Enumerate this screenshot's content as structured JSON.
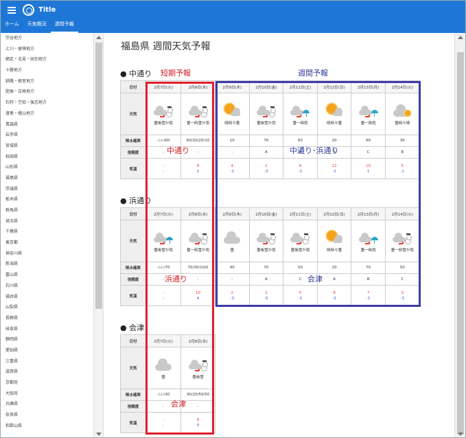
{
  "app": {
    "title": "Title"
  },
  "nav": {
    "tabs": [
      {
        "label": "ホーム"
      },
      {
        "label": "天気概況"
      },
      {
        "label": "週間予報"
      }
    ]
  },
  "sidebar": {
    "items": [
      "宗谷地方",
      "上川・留萌地方",
      "網走・北見・紋別地方",
      "十勝地方",
      "釧路・根室地方",
      "胆振・日高地方",
      "石狩・空知・後志地方",
      "渡島・檜山地方",
      "青森県",
      "岩手県",
      "宮城県",
      "秋田県",
      "山形県",
      "福島県",
      "茨城県",
      "栃木県",
      "群馬県",
      "埼玉県",
      "千葉県",
      "東京都",
      "神奈川県",
      "新潟県",
      "富山県",
      "石川県",
      "福井県",
      "山梨県",
      "長野県",
      "岐阜県",
      "静岡県",
      "愛知県",
      "三重県",
      "滋賀県",
      "京都府",
      "大阪府",
      "兵庫県",
      "奈良県",
      "和歌山県"
    ]
  },
  "page": {
    "title": "福島県 週間天気予報"
  },
  "row_labels": {
    "date": "日付",
    "weather": "天気",
    "pop": "降水確率",
    "reliability": "信頼度",
    "temp": "気温"
  },
  "sections": [
    {
      "name": "中通り",
      "days": [
        {
          "date": "2月7日(火)",
          "icon": "cloud-snow-icon",
          "weather": "曇後雪か雨",
          "pop": "-/-/-/60",
          "rel": "-",
          "tmax": "-",
          "tmin": "-"
        },
        {
          "date": "2月8日(水)",
          "icon": "cloud-snow-icon",
          "weather": "曇一時雪か雨",
          "pop": "60/20/20/10",
          "rel": "-",
          "tmax": "8",
          "tmin": "1"
        },
        {
          "date": "2月9日(木)",
          "icon": "sun-cloud-icon",
          "weather": "晴時々曇",
          "pop": "10",
          "rel": "-",
          "tmax": "4",
          "tmin": "-1"
        },
        {
          "date": "2月10日(金)",
          "icon": "cloud-snow-icon",
          "weather": "曇後雪か雨",
          "pop": "70",
          "rel": "A",
          "tmax": "2",
          "tmin": "-3"
        },
        {
          "date": "2月11日(土)",
          "icon": "cloud-rain-icon",
          "weather": "曇一時雨",
          "pop": "60",
          "rel": "A",
          "tmax": "9",
          "tmin": "-1"
        },
        {
          "date": "2月12日(日)",
          "icon": "sun-cloud-icon",
          "weather": "晴時々曇",
          "pop": "20",
          "rel": "A",
          "tmax": "12",
          "tmin": "-2"
        },
        {
          "date": "2月13日(月)",
          "icon": "cloud-rain-icon",
          "weather": "曇一時雨",
          "pop": "60",
          "rel": "C",
          "tmax": "10",
          "tmin": "1"
        },
        {
          "date": "2月14日(火)",
          "icon": "cloud-sun-icon",
          "weather": "曇時々晴",
          "pop": "30",
          "rel": "B",
          "tmax": "5",
          "tmin": "-1"
        }
      ]
    },
    {
      "name": "浜通り",
      "days": [
        {
          "date": "2月7日(火)",
          "icon": "cloud-rain-icon",
          "weather": "曇後雪か雨",
          "pop": "-/-/-/70",
          "rel": "-",
          "tmax": "-",
          "tmin": "-"
        },
        {
          "date": "2月8日(水)",
          "icon": "cloud-snow-icon",
          "weather": "曇一時雪か雨",
          "pop": "70/30/10/0",
          "rel": "-",
          "tmax": "10",
          "tmin": "4"
        },
        {
          "date": "2月9日(木)",
          "icon": "cloud-icon",
          "weather": "曇",
          "pop": "40",
          "rel": "-",
          "tmax": "2",
          "tmin": "-3"
        },
        {
          "date": "2月10日(金)",
          "icon": "cloud-snow-icon",
          "weather": "曇後雪か雨",
          "pop": "70",
          "rel": "A",
          "tmax": "2",
          "tmin": "-5"
        },
        {
          "date": "2月11日(土)",
          "icon": "cloud-snow-icon",
          "weather": "曇後雪か雨",
          "pop": "50",
          "rel": "C",
          "tmax": "5",
          "tmin": "-1"
        },
        {
          "date": "2月12日(日)",
          "icon": "sun-cloud-icon",
          "weather": "晴時々曇",
          "pop": "20",
          "rel": "A",
          "tmax": "8",
          "tmin": "-5"
        },
        {
          "date": "2月13日(月)",
          "icon": "cloud-rain-icon",
          "weather": "曇一時雨",
          "pop": "70",
          "rel": "B",
          "tmax": "7",
          "tmin": "-1"
        },
        {
          "date": "2月14日(火)",
          "icon": "cloud-snow-icon",
          "weather": "曇一時雪か雨",
          "pop": "50",
          "rel": "C",
          "tmax": "3",
          "tmin": "-3"
        }
      ]
    },
    {
      "name": "会津",
      "days": [
        {
          "date": "2月7日(火)",
          "icon": "cloud-icon",
          "weather": "曇",
          "pop": "-/-/-/30",
          "rel": "-",
          "tmax": "-",
          "tmin": "-"
        },
        {
          "date": "2月8日(水)",
          "icon": "cloud-snow-icon",
          "weather": "曇後雪",
          "pop": "30/20/50/50",
          "rel": "-",
          "tmax": "6",
          "tmin": "0"
        }
      ]
    }
  ],
  "annotations": {
    "short_term": "短期予報",
    "weekly": "週間予報",
    "naka": "中通り",
    "naka_hama": "中通り･浜通り",
    "hama": "浜通り",
    "aizu_short": "会津",
    "aizu_weekly": "会津"
  },
  "colors": {
    "primary": "#1e77d6",
    "annotation_red": "#e21e2c",
    "annotation_blue": "#3c3ca8",
    "temp_max": "#e53a2c",
    "temp_min": "#1f5fd6"
  }
}
